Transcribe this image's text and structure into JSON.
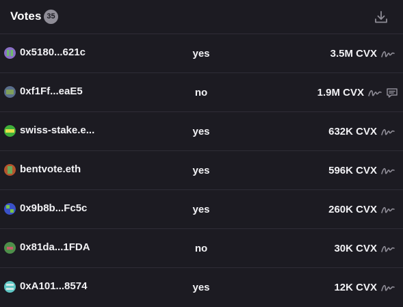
{
  "header": {
    "title": "Votes",
    "count": "35",
    "download_icon": "download-icon"
  },
  "votes": [
    {
      "voter": "0x5180...621c",
      "choice": "yes",
      "power": "3.5M CVX",
      "avatar_colors": [
        "#8a6fc7",
        "#6dbb6a"
      ],
      "has_comment": false
    },
    {
      "voter": "0xf1Ff...eaE5",
      "choice": "no",
      "power": "1.9M CVX",
      "avatar_colors": [
        "#5a6e8c",
        "#7fa05a"
      ],
      "has_comment": true
    },
    {
      "voter": "swiss-stake.e...",
      "choice": "yes",
      "power": "632K CVX",
      "avatar_colors": [
        "#3fae3a",
        "#e6e04a"
      ],
      "has_comment": false
    },
    {
      "voter": "bentvote.eth",
      "choice": "yes",
      "power": "596K CVX",
      "avatar_colors": [
        "#b5552d",
        "#6aa85a"
      ],
      "has_comment": false
    },
    {
      "voter": "0x9b8b...Fc5c",
      "choice": "yes",
      "power": "260K CVX",
      "avatar_colors": [
        "#3a52c9",
        "#79c24a"
      ],
      "has_comment": false
    },
    {
      "voter": "0x81da...1FDA",
      "choice": "no",
      "power": "30K CVX",
      "avatar_colors": [
        "#4e8f4a",
        "#c95b6a"
      ],
      "has_comment": false
    },
    {
      "voter": "0xA101...8574",
      "choice": "yes",
      "power": "12K CVX",
      "avatar_colors": [
        "#5fc6c4",
        "#d3e8e6"
      ],
      "has_comment": false
    }
  ],
  "icons": {
    "signature": "signature-icon",
    "comment": "comment-icon"
  },
  "colors": {
    "background": "#1c1b22",
    "divider": "#2f2d37",
    "text": "#f2f2f5",
    "muted": "#8f8d97"
  }
}
